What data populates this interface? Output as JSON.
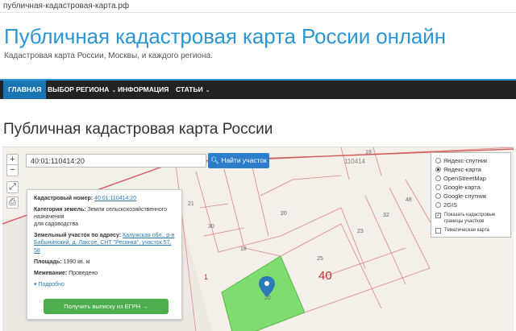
{
  "browser": {
    "url": "публичная-кадастровая-карта.рф"
  },
  "site": {
    "title": "Публичная кадастровая карта России онлайн",
    "subtitle": "Кадастровая карта России, Москвы, и каждого региона."
  },
  "nav": {
    "items": [
      {
        "label": "ГЛАВНАЯ"
      },
      {
        "label": "ВЫБОР РЕГИОНА"
      },
      {
        "label": "ИНФОРМАЦИЯ"
      },
      {
        "label": "СТАТЬИ"
      }
    ]
  },
  "page": {
    "heading": "Публичная кадастровая карта России"
  },
  "map": {
    "zoom_in": "+",
    "zoom_out": "−",
    "search": {
      "value": "40:01:110414:20",
      "button_label": "Найти участок"
    },
    "labels": {
      "block": "110414",
      "big_40": "40",
      "p19": "19",
      "p21": "21",
      "p30": "30",
      "p20": "20",
      "p18": "18",
      "p25": "25",
      "p23": "23",
      "p32": "32",
      "p48": "48",
      "p1": "1",
      "p20b": "20"
    },
    "info": {
      "cadnum_label": "Кадастровый номер:",
      "cadnum_value": "40:01:110414:20",
      "category_label": "Категория земель:",
      "category_value": "Земли сельскохозяйственного назначения",
      "category_value2": "для садоводства",
      "address_label": "Земельный участок по адресу:",
      "address_value": "Калужская обл., р-н Бабынинский, д. Лаксое, СНТ \"Ресинка\", участок 57, 58",
      "area_label": "Площадь:",
      "area_value": "1990 кв. м",
      "survey_label": "Межевание:",
      "survey_value": "Проведено",
      "more": "Подробно",
      "egrn_button": "Получить выписку из ЕГРН →"
    },
    "layers": {
      "options": [
        {
          "label": "Яндекс-спутник",
          "selected": false
        },
        {
          "label": "Яндекс-карта",
          "selected": true
        },
        {
          "label": "OpenStreetMap",
          "selected": false
        },
        {
          "label": "Google-карта",
          "selected": false
        },
        {
          "label": "Google-спутник",
          "selected": false
        },
        {
          "label": "2GIS",
          "selected": false
        }
      ],
      "show_borders": "Показать кадастровые границы участков",
      "show_borders_checked": true,
      "thematic": "Тематическая карта",
      "thematic_checked": false
    },
    "colors": {
      "parcel_fill": "#7fdc6f",
      "border": "#d45a5a",
      "pin": "#2a7ab8"
    }
  }
}
